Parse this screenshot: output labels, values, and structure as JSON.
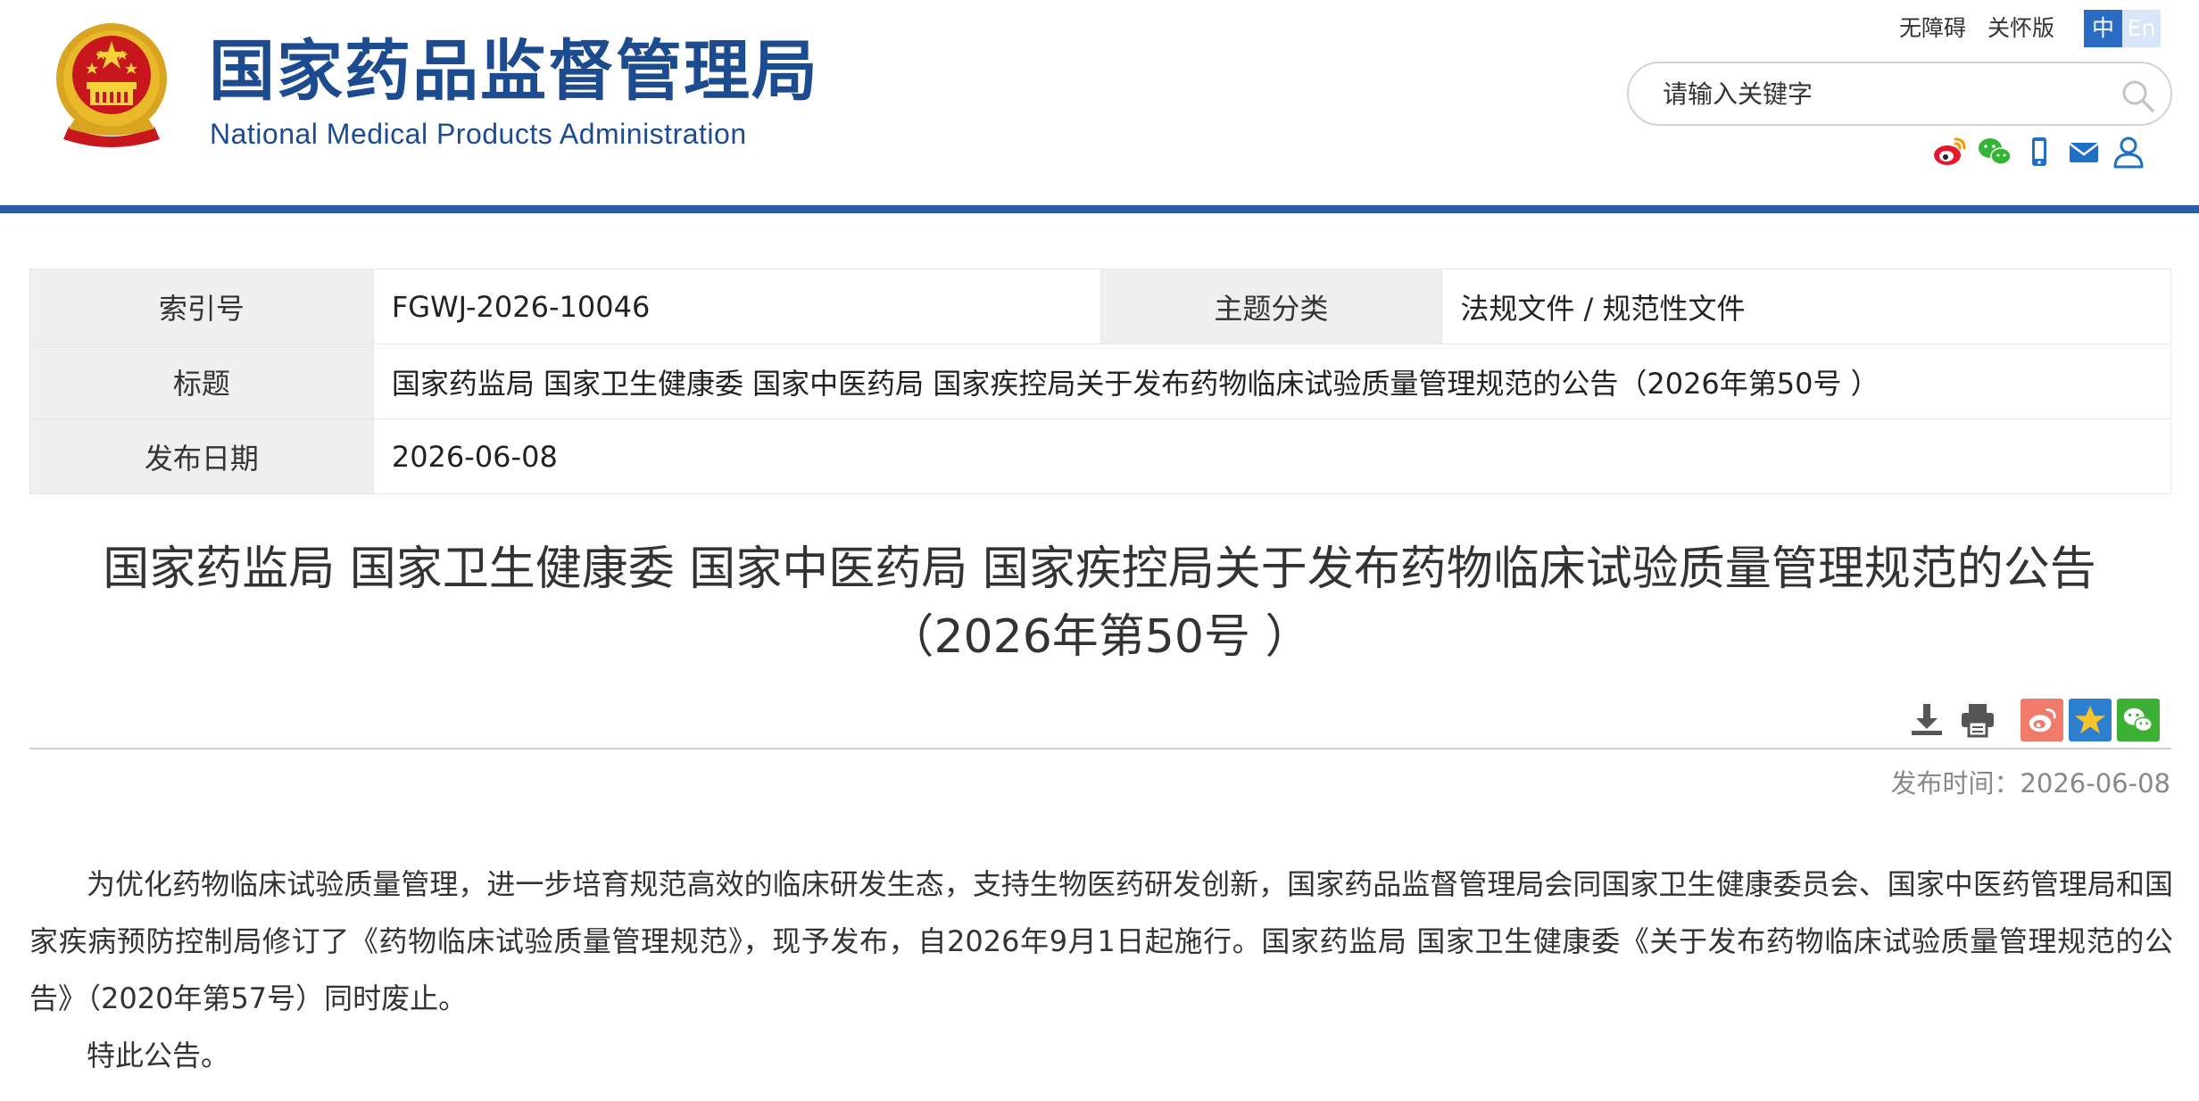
{
  "header": {
    "title_cn": "国家药品监督管理局",
    "title_en": "National Medical Products Administration",
    "links": {
      "accessible": "无障碍",
      "care": "关怀版"
    },
    "lang": {
      "zh": "中",
      "en": "En"
    },
    "search_placeholder": "请输入关键字",
    "social_icons": [
      "weibo-icon",
      "wechat-icon",
      "mobile-icon",
      "mail-icon",
      "user-icon"
    ],
    "colors": {
      "brand": "#1d4b8f",
      "bar": "#2a5ca5"
    }
  },
  "info": {
    "index_label": "索引号",
    "index_value": "FGWJ-2026-10046",
    "category_label": "主题分类",
    "category_value": "法规文件 / 规范性文件",
    "title_label": "标题",
    "title_value": "国家药监局 国家卫生健康委 国家中医药局 国家疾控局关于发布药物临床试验质量管理规范的公告（2026年第50号 ）",
    "date_label": "发布日期",
    "date_value": "2026-06-08"
  },
  "article": {
    "title_line1": "国家药监局 国家卫生健康委 国家中医药局 国家疾控局关于发布药物临床试验质量管理规范的公告",
    "title_line2": "（2026年第50号 ）",
    "publish_time": "发布时间：2026-06-08",
    "paragraph1": "为优化药物临床试验质量管理，进一步培育规范高效的临床研发生态，支持生物医药研发创新，国家药品监督管理局会同国家卫生健康委员会、国家中医药管理局和国家疾病预防控制局修订了《药物临床试验质量管理规范》，现予发布，自2026年9月1日起施行。国家药监局 国家卫生健康委《关于发布药物临床试验质量管理规范的公告》（2020年第57号）同时废止。",
    "paragraph2": "特此公告。"
  },
  "tools": {
    "icons": [
      "download-icon",
      "print-icon"
    ],
    "share_icons": [
      "weibo-share-icon",
      "favorite-star-icon",
      "wechat-share-icon"
    ],
    "share_colors": {
      "weibo": "#f07b6a",
      "star": "#2d7fd0",
      "wechat": "#3cb034"
    }
  }
}
